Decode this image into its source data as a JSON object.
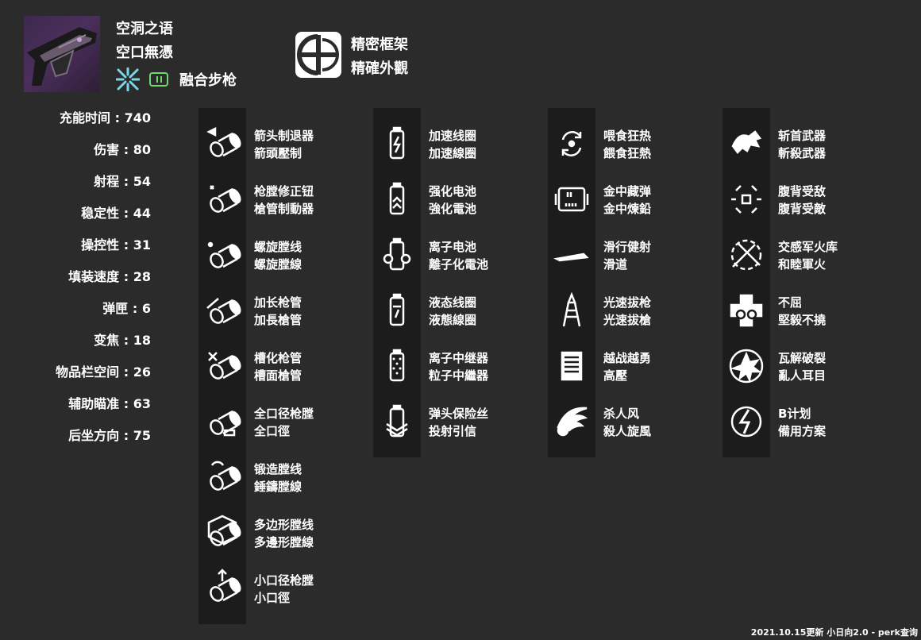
{
  "weapon": {
    "name_cn": "空洞之语",
    "name_tw": "空口無憑",
    "element_icon": "arc-icon",
    "ammo_icon": "primary-ammo-icon",
    "type_label": "融合步枪",
    "frame_icon": "precision-frame-icon",
    "frame_cn": "精密框架",
    "frame_tw": "精確外觀"
  },
  "stats": [
    {
      "label": "充能时间",
      "value": "740"
    },
    {
      "label": "伤害",
      "value": "80"
    },
    {
      "label": "射程",
      "value": "54"
    },
    {
      "label": "稳定性",
      "value": "44"
    },
    {
      "label": "操控性",
      "value": "31"
    },
    {
      "label": "填装速度",
      "value": "28"
    },
    {
      "label": "弹匣",
      "value": "6"
    },
    {
      "label": "变焦",
      "value": "18"
    },
    {
      "label": "物品栏空间",
      "value": "26"
    },
    {
      "label": "辅助瞄准",
      "value": "63"
    },
    {
      "label": "后坐方向",
      "value": "75"
    }
  ],
  "columns": [
    {
      "perks": [
        {
          "cn": "箭头制退器",
          "tw": "箭頭壓制",
          "icon": "arrowhead-brake-icon"
        },
        {
          "cn": "枪膛修正钮",
          "tw": "槍管制動器",
          "icon": "corkscrew-rifling-icon"
        },
        {
          "cn": "螺旋膛线",
          "tw": "螺旋膛線",
          "icon": "fluted-barrel-icon"
        },
        {
          "cn": "加长枪管",
          "tw": "加長槍管",
          "icon": "extended-barrel-icon"
        },
        {
          "cn": "槽化枪管",
          "tw": "槽面槍管",
          "icon": "chambered-compensator-icon"
        },
        {
          "cn": "全口径枪膛",
          "tw": "全口徑",
          "icon": "full-bore-icon"
        },
        {
          "cn": "锻造膛线",
          "tw": "錘鑄膛線",
          "icon": "hammer-forged-rifling-icon"
        },
        {
          "cn": "多边形膛线",
          "tw": "多邊形膛線",
          "icon": "polygonal-rifling-icon"
        },
        {
          "cn": "小口径枪膛",
          "tw": "小口徑",
          "icon": "smallbore-icon"
        }
      ]
    },
    {
      "perks": [
        {
          "cn": "加速线圈",
          "tw": "加速線圈",
          "icon": "accelerated-coils-icon"
        },
        {
          "cn": "强化电池",
          "tw": "強化電池",
          "icon": "enhanced-battery-icon"
        },
        {
          "cn": "离子电池",
          "tw": "離子化電池",
          "icon": "ionized-battery-icon"
        },
        {
          "cn": "液态线圈",
          "tw": "液態線圈",
          "icon": "liquid-coils-icon"
        },
        {
          "cn": "离子中继器",
          "tw": "粒子中繼器",
          "icon": "particle-repeater-icon"
        },
        {
          "cn": "弹头保险丝",
          "tw": "投射引信",
          "icon": "projection-fuse-icon"
        }
      ]
    },
    {
      "perks": [
        {
          "cn": "喂食狂热",
          "tw": "餵食狂熱",
          "icon": "feeding-frenzy-icon"
        },
        {
          "cn": "金中藏弹",
          "tw": "金中煉鉛",
          "icon": "ammo-chamber-icon"
        },
        {
          "cn": "滑行健射",
          "tw": "滑道",
          "icon": "slideshot-icon"
        },
        {
          "cn": "光速拔枪",
          "tw": "光速拔槍",
          "icon": "quickdraw-icon"
        },
        {
          "cn": "越战越勇",
          "tw": "高壓",
          "icon": "high-pressure-icon"
        },
        {
          "cn": "杀人风",
          "tw": "殺人旋風",
          "icon": "winged-skull-icon"
        }
      ]
    },
    {
      "perks": [
        {
          "cn": "斩首武器",
          "tw": "斬殺武器",
          "icon": "dragon-icon"
        },
        {
          "cn": "腹背受敌",
          "tw": "腹背受敵",
          "icon": "surrounded-icon"
        },
        {
          "cn": "交感军火库",
          "tw": "和睦軍火",
          "icon": "crossed-guns-icon"
        },
        {
          "cn": "不屈",
          "tw": "堅毅不撓",
          "icon": "cross-icon"
        },
        {
          "cn": "瓦解破裂",
          "tw": "亂人耳目",
          "icon": "explosion-icon"
        },
        {
          "cn": "B计划",
          "tw": "備用方案",
          "icon": "plan-b-icon"
        }
      ]
    }
  ],
  "footer": "2021.10.15更新 小日向2.0 - perk查询",
  "colors": {
    "background": "#2b2b2b",
    "column": "#1c1c1c",
    "arc": "#79d7e8",
    "ammo": "#6fd86f"
  }
}
